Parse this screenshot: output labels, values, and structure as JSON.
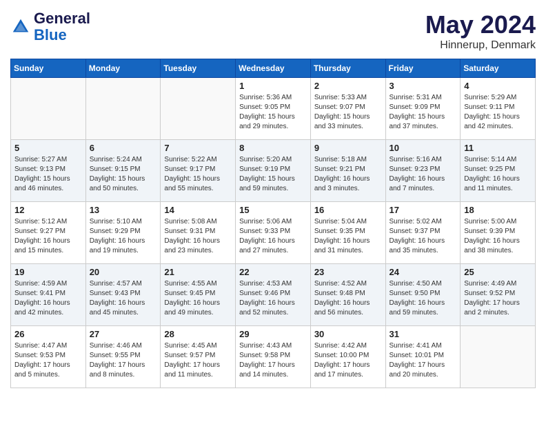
{
  "header": {
    "logo_line1": "General",
    "logo_line2": "Blue",
    "month": "May 2024",
    "location": "Hinnerup, Denmark"
  },
  "weekdays": [
    "Sunday",
    "Monday",
    "Tuesday",
    "Wednesday",
    "Thursday",
    "Friday",
    "Saturday"
  ],
  "weeks": [
    [
      {
        "day": "",
        "info": ""
      },
      {
        "day": "",
        "info": ""
      },
      {
        "day": "",
        "info": ""
      },
      {
        "day": "1",
        "info": "Sunrise: 5:36 AM\nSunset: 9:05 PM\nDaylight: 15 hours\nand 29 minutes."
      },
      {
        "day": "2",
        "info": "Sunrise: 5:33 AM\nSunset: 9:07 PM\nDaylight: 15 hours\nand 33 minutes."
      },
      {
        "day": "3",
        "info": "Sunrise: 5:31 AM\nSunset: 9:09 PM\nDaylight: 15 hours\nand 37 minutes."
      },
      {
        "day": "4",
        "info": "Sunrise: 5:29 AM\nSunset: 9:11 PM\nDaylight: 15 hours\nand 42 minutes."
      }
    ],
    [
      {
        "day": "5",
        "info": "Sunrise: 5:27 AM\nSunset: 9:13 PM\nDaylight: 15 hours\nand 46 minutes."
      },
      {
        "day": "6",
        "info": "Sunrise: 5:24 AM\nSunset: 9:15 PM\nDaylight: 15 hours\nand 50 minutes."
      },
      {
        "day": "7",
        "info": "Sunrise: 5:22 AM\nSunset: 9:17 PM\nDaylight: 15 hours\nand 55 minutes."
      },
      {
        "day": "8",
        "info": "Sunrise: 5:20 AM\nSunset: 9:19 PM\nDaylight: 15 hours\nand 59 minutes."
      },
      {
        "day": "9",
        "info": "Sunrise: 5:18 AM\nSunset: 9:21 PM\nDaylight: 16 hours\nand 3 minutes."
      },
      {
        "day": "10",
        "info": "Sunrise: 5:16 AM\nSunset: 9:23 PM\nDaylight: 16 hours\nand 7 minutes."
      },
      {
        "day": "11",
        "info": "Sunrise: 5:14 AM\nSunset: 9:25 PM\nDaylight: 16 hours\nand 11 minutes."
      }
    ],
    [
      {
        "day": "12",
        "info": "Sunrise: 5:12 AM\nSunset: 9:27 PM\nDaylight: 16 hours\nand 15 minutes."
      },
      {
        "day": "13",
        "info": "Sunrise: 5:10 AM\nSunset: 9:29 PM\nDaylight: 16 hours\nand 19 minutes."
      },
      {
        "day": "14",
        "info": "Sunrise: 5:08 AM\nSunset: 9:31 PM\nDaylight: 16 hours\nand 23 minutes."
      },
      {
        "day": "15",
        "info": "Sunrise: 5:06 AM\nSunset: 9:33 PM\nDaylight: 16 hours\nand 27 minutes."
      },
      {
        "day": "16",
        "info": "Sunrise: 5:04 AM\nSunset: 9:35 PM\nDaylight: 16 hours\nand 31 minutes."
      },
      {
        "day": "17",
        "info": "Sunrise: 5:02 AM\nSunset: 9:37 PM\nDaylight: 16 hours\nand 35 minutes."
      },
      {
        "day": "18",
        "info": "Sunrise: 5:00 AM\nSunset: 9:39 PM\nDaylight: 16 hours\nand 38 minutes."
      }
    ],
    [
      {
        "day": "19",
        "info": "Sunrise: 4:59 AM\nSunset: 9:41 PM\nDaylight: 16 hours\nand 42 minutes."
      },
      {
        "day": "20",
        "info": "Sunrise: 4:57 AM\nSunset: 9:43 PM\nDaylight: 16 hours\nand 45 minutes."
      },
      {
        "day": "21",
        "info": "Sunrise: 4:55 AM\nSunset: 9:45 PM\nDaylight: 16 hours\nand 49 minutes."
      },
      {
        "day": "22",
        "info": "Sunrise: 4:53 AM\nSunset: 9:46 PM\nDaylight: 16 hours\nand 52 minutes."
      },
      {
        "day": "23",
        "info": "Sunrise: 4:52 AM\nSunset: 9:48 PM\nDaylight: 16 hours\nand 56 minutes."
      },
      {
        "day": "24",
        "info": "Sunrise: 4:50 AM\nSunset: 9:50 PM\nDaylight: 16 hours\nand 59 minutes."
      },
      {
        "day": "25",
        "info": "Sunrise: 4:49 AM\nSunset: 9:52 PM\nDaylight: 17 hours\nand 2 minutes."
      }
    ],
    [
      {
        "day": "26",
        "info": "Sunrise: 4:47 AM\nSunset: 9:53 PM\nDaylight: 17 hours\nand 5 minutes."
      },
      {
        "day": "27",
        "info": "Sunrise: 4:46 AM\nSunset: 9:55 PM\nDaylight: 17 hours\nand 8 minutes."
      },
      {
        "day": "28",
        "info": "Sunrise: 4:45 AM\nSunset: 9:57 PM\nDaylight: 17 hours\nand 11 minutes."
      },
      {
        "day": "29",
        "info": "Sunrise: 4:43 AM\nSunset: 9:58 PM\nDaylight: 17 hours\nand 14 minutes."
      },
      {
        "day": "30",
        "info": "Sunrise: 4:42 AM\nSunset: 10:00 PM\nDaylight: 17 hours\nand 17 minutes."
      },
      {
        "day": "31",
        "info": "Sunrise: 4:41 AM\nSunset: 10:01 PM\nDaylight: 17 hours\nand 20 minutes."
      },
      {
        "day": "",
        "info": ""
      }
    ]
  ]
}
